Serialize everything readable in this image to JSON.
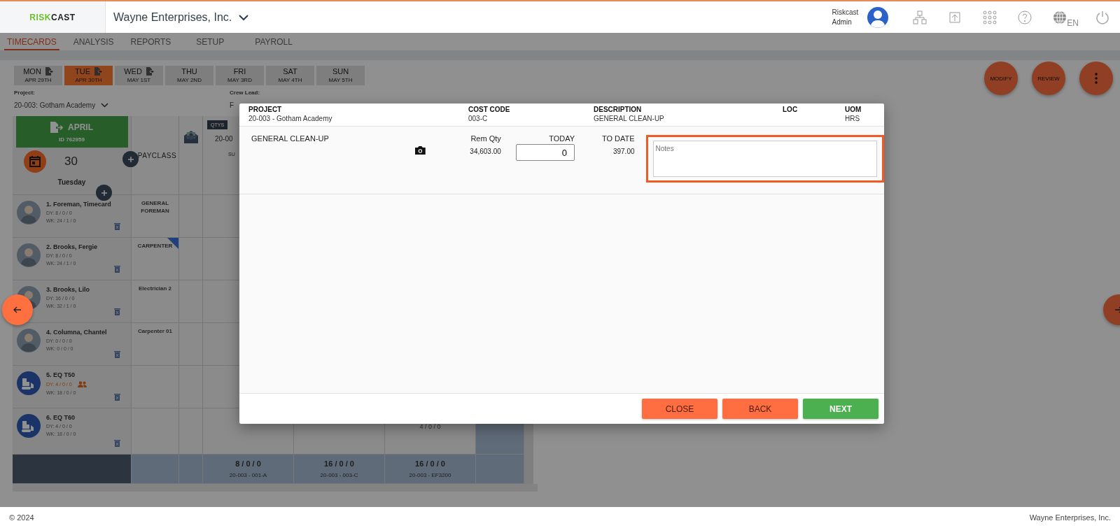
{
  "header": {
    "logo": {
      "part_1": "RISK",
      "part_2": "CAST"
    },
    "company": "Wayne Enterprises, Inc.",
    "user": {
      "line_1": "Riskcast",
      "line_2": "Admin"
    },
    "language": "EN"
  },
  "tabs": [
    {
      "label": "TIMECARDS",
      "selected": true
    },
    {
      "label": "ANALYSIS",
      "selected": false
    },
    {
      "label": "REPORTS",
      "selected": false
    },
    {
      "label": "SETUP",
      "selected": false
    },
    {
      "label": "PAYROLL",
      "selected": false
    }
  ],
  "days": [
    {
      "day": "MON",
      "date": "APR 29TH",
      "exported": true,
      "selected": false
    },
    {
      "day": "TUE",
      "date": "APR 30TH",
      "exported": true,
      "selected": true
    },
    {
      "day": "WED",
      "date": "MAY 1ST",
      "exported": true,
      "selected": false
    },
    {
      "day": "THU",
      "date": "MAY 2ND",
      "exported": false,
      "selected": false
    },
    {
      "day": "FRI",
      "date": "MAY 3RD",
      "exported": false,
      "selected": false
    },
    {
      "day": "SAT",
      "date": "MAY 4TH",
      "exported": false,
      "selected": false
    },
    {
      "day": "SUN",
      "date": "MAY 5TH",
      "exported": false,
      "selected": false
    }
  ],
  "actions": [
    "MODIFY",
    "REVIEW"
  ],
  "filters": {
    "project_label": "Project:",
    "project_value": "20-003: Gotham Academy",
    "crew_lead_label": "Crew Lead:",
    "crew_lead_value": "F"
  },
  "day_card": {
    "month": "APRIL",
    "id": "ID 762959",
    "day_number": "30",
    "weekday": "Tuesday"
  },
  "table": {
    "payclass_header": "PAYCLASS",
    "qty_badge": "QTYS",
    "qty_column": "20-00",
    "qty_sub": "SU",
    "employees": [
      {
        "name": "1. Foreman, Timecard",
        "dy": "DY: 8 / 0 / 0",
        "wk": "WK: 24 / 1 / 0",
        "kind": "person",
        "alert": false,
        "payclass": "GENERAL FOREMAN",
        "flagged": false
      },
      {
        "name": "2. Brooks, Fergie",
        "dy": "DY: 8 / 0 / 0",
        "wk": "WK: 24 / 1 / 0",
        "kind": "person",
        "alert": false,
        "payclass": "CARPENTER",
        "flagged": true
      },
      {
        "name": "3. Brooks, Lilo",
        "dy": "DY: 16 / 0 / 0",
        "wk": "WK: 32 / 1 / 0",
        "kind": "person",
        "alert": false,
        "payclass": "Electrician 2",
        "flagged": false
      },
      {
        "name": "4. Columna, Chantel",
        "dy": "DY: 0 / 0 / 0",
        "wk": "WK: 0 / 0 / 0",
        "kind": "person",
        "alert": false,
        "payclass": "Carpenter 01",
        "flagged": false
      },
      {
        "name": "5. EQ T50",
        "dy": "DY: 4 / 0 / 0",
        "wk": "WK: 18 / 0 / 0",
        "kind": "equipment",
        "alert": true,
        "flagged": false
      },
      {
        "name": "6. EQ T60",
        "dy": "DY: 4 / 0 / 0",
        "wk": "WK: 18 / 0 / 0",
        "kind": "equipment",
        "alert": false,
        "flagged": false,
        "qty_column_3": "4 / 0 / 0"
      }
    ],
    "totals": [
      {
        "value": "8 / 0 / 0",
        "code": "20-003 - 001-A"
      },
      {
        "value": "16 / 0 / 0",
        "code": "20-003 - 003-C"
      },
      {
        "value": "16 / 0 / 0",
        "code": "20-003 - EF3200"
      }
    ]
  },
  "modal": {
    "fields": [
      {
        "label": "PROJECT",
        "value": "20-003 - Gotham Academy"
      },
      {
        "label": "COST CODE",
        "value": "003-C"
      },
      {
        "label": "DESCRIPTION",
        "value": "GENERAL CLEAN-UP"
      },
      {
        "label": "LOC"
      },
      {
        "label": "UOM",
        "value": "HRS"
      }
    ],
    "item": {
      "title": "GENERAL CLEAN-UP",
      "rem_qty_label": "Rem Qty",
      "rem_qty": "34,603.00",
      "today_label": "TODAY",
      "today_value": "0",
      "to_date_label": "TO DATE",
      "to_date": "397.00",
      "notes_placeholder": "Notes",
      "notes_highlighted": true
    },
    "buttons": [
      {
        "label": "CLOSE",
        "kind": "secondary"
      },
      {
        "label": "BACK",
        "kind": "secondary"
      },
      {
        "label": "NEXT",
        "kind": "primary"
      }
    ]
  },
  "footer": {
    "copyright": "© 2024",
    "company": "Wayne Enterprises, Inc."
  }
}
